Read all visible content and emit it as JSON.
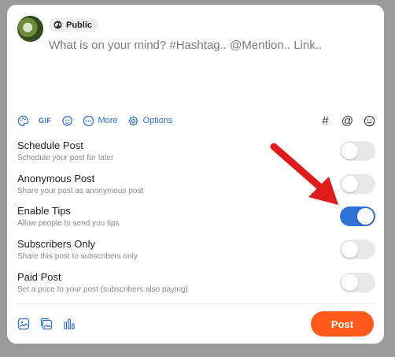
{
  "composer": {
    "privacy_label": "Public",
    "placeholder": "What is on your mind? #Hashtag.. @Mention.. Link.."
  },
  "toolbar": {
    "gif_label": "GIF",
    "more_label": "More",
    "options_label": "Options",
    "hashtag_symbol": "#",
    "mention_symbol": "@"
  },
  "options": [
    {
      "title": "Schedule Post",
      "desc": "Schedule your post for later",
      "enabled": false
    },
    {
      "title": "Anonymous Post",
      "desc": "Share your post as anonymous post",
      "enabled": false
    },
    {
      "title": "Enable Tips",
      "desc": "Allow people to send you tips",
      "enabled": true
    },
    {
      "title": "Subscribers Only",
      "desc": "Share this post to subscribers only",
      "enabled": false
    },
    {
      "title": "Paid Post",
      "desc": "Set a price to your post (subscribers also paying)",
      "enabled": false
    }
  ],
  "post_label": "Post",
  "colors": {
    "accent": "#2f73d6",
    "post": "#ff5a1a",
    "arrow": "#e01b1b"
  }
}
